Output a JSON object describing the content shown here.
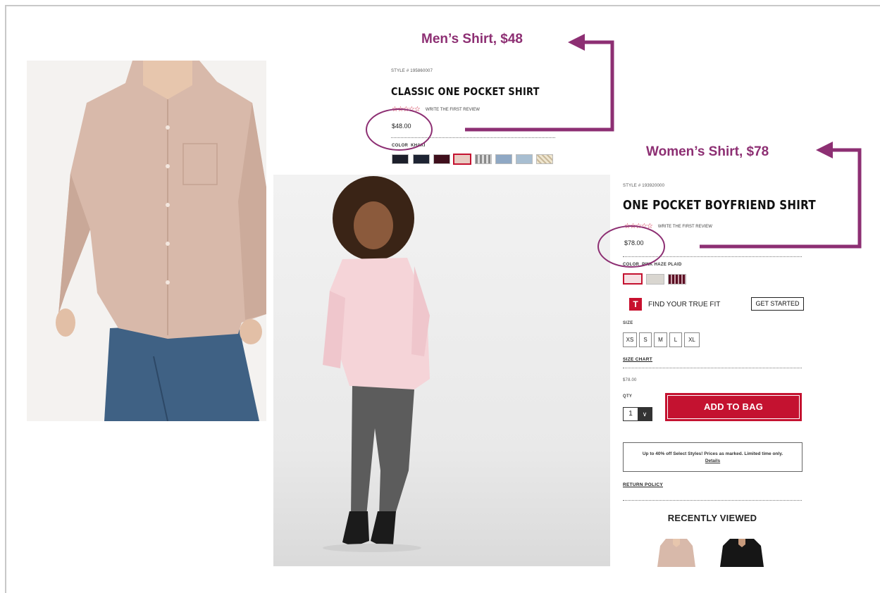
{
  "men_product": {
    "style_number": "STYLE # 195860007",
    "title": "CLASSIC ONE POCKET SHIRT",
    "stars": "☆☆☆☆☆",
    "review_link": "WRITE THE FIRST REVIEW",
    "price": "$48.00",
    "color_label": "COLOR",
    "color_value": "KHAKI"
  },
  "women_product": {
    "style_number": "STYLE # 193920000",
    "title": "ONE POCKET BOYFRIEND SHIRT",
    "stars": "☆☆☆☆☆",
    "review_link": "WRITE THE FIRST REVIEW",
    "price": "$78.00",
    "color_label": "COLOR",
    "color_value": "PINK HAZE PLAID",
    "truefit_badge": "T",
    "truefit_text": "FIND YOUR TRUE FIT",
    "get_started": "GET STARTED",
    "size_label": "SIZE",
    "sizes": [
      "XS",
      "S",
      "M",
      "L",
      "XL"
    ],
    "size_chart": "SIZE CHART",
    "price_repeat": "$78.00",
    "qty_label": "QTY",
    "qty_value": "1",
    "add_to_bag": "ADD TO BAG",
    "promo_text": "Up to 40% off Select Styles! Prices as marked. Limited time only.",
    "promo_link": "Details",
    "return_policy": "RETURN POLICY",
    "recently_viewed": "RECENTLY VIEWED"
  },
  "annotations": {
    "men": "Men’s Shirt, $48",
    "women": "Women’s Shirt, $78"
  },
  "colors": {
    "accent_red": "#c41230",
    "annotation_purple": "#8d2f73"
  }
}
